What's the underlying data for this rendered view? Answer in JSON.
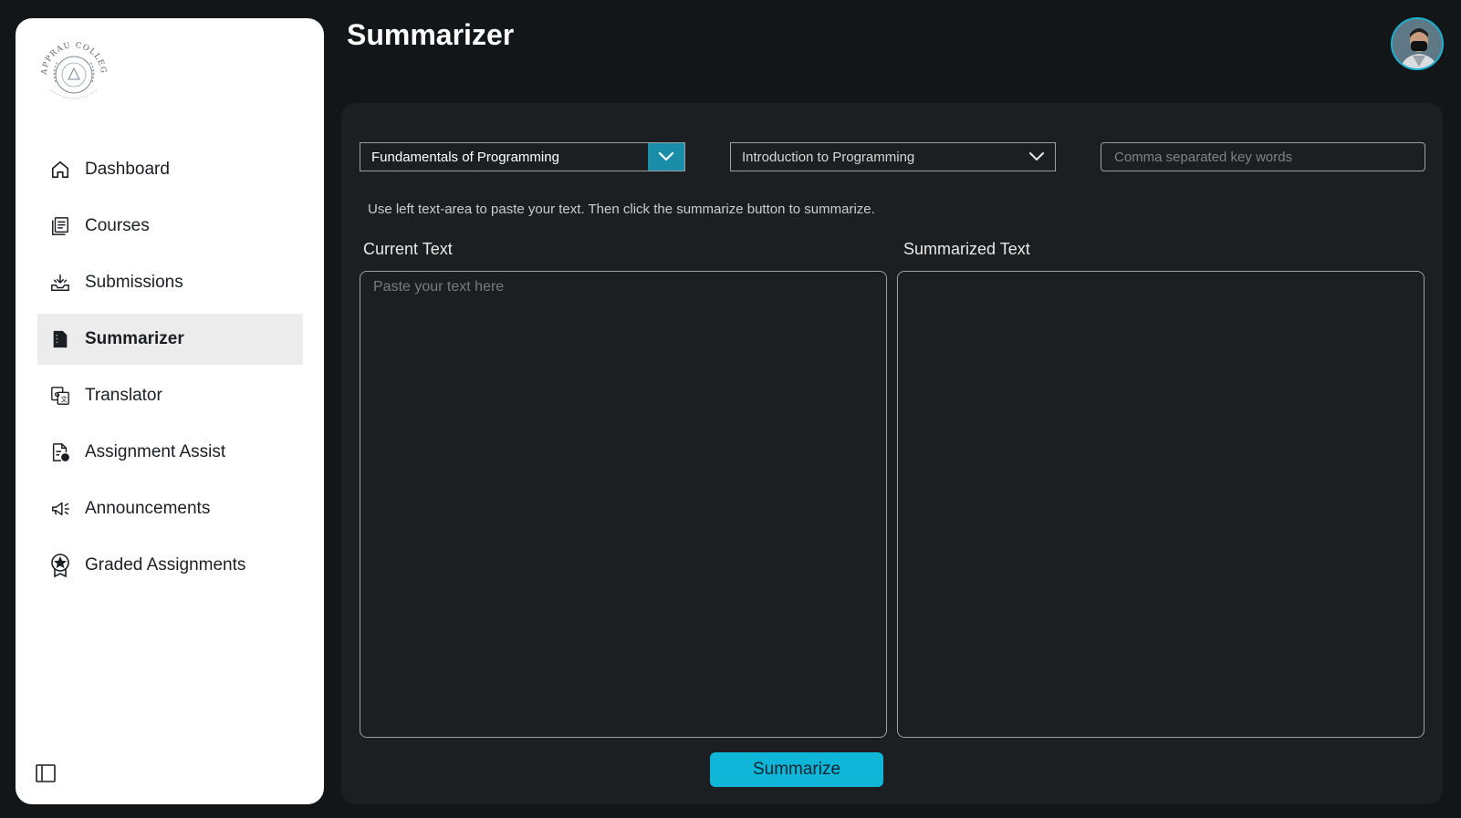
{
  "page": {
    "title": "Summarizer"
  },
  "brand": {
    "logo_text": "APPRAU COLLEGE",
    "accent_color": "#0fb5d6"
  },
  "sidebar": {
    "items": [
      {
        "label": "Dashboard",
        "icon": "home-icon",
        "active": false
      },
      {
        "label": "Courses",
        "icon": "courses-icon",
        "active": false
      },
      {
        "label": "Submissions",
        "icon": "submissions-icon",
        "active": false
      },
      {
        "label": "Summarizer",
        "icon": "summarizer-icon",
        "active": true
      },
      {
        "label": "Translator",
        "icon": "translator-icon",
        "active": false
      },
      {
        "label": "Assignment Assist",
        "icon": "assignment-assist-icon",
        "active": false
      },
      {
        "label": "Announcements",
        "icon": "megaphone-icon",
        "active": false
      },
      {
        "label": "Graded Assignments",
        "icon": "badge-icon",
        "active": false
      }
    ],
    "collapse_icon": "sidebar-toggle-icon"
  },
  "controls": {
    "course_select": "Fundamentals of Programming",
    "topic_select": "Introduction to Programming",
    "keywords_placeholder": "Comma separated key words"
  },
  "hint": "Use left text-area to paste your text. Then click the summarize button to summarize.",
  "current_text": {
    "label": "Current Text",
    "placeholder": "Paste your text here",
    "value": ""
  },
  "summarized_text": {
    "label": "Summarized Text",
    "value": ""
  },
  "summarize_button": "Summarize"
}
